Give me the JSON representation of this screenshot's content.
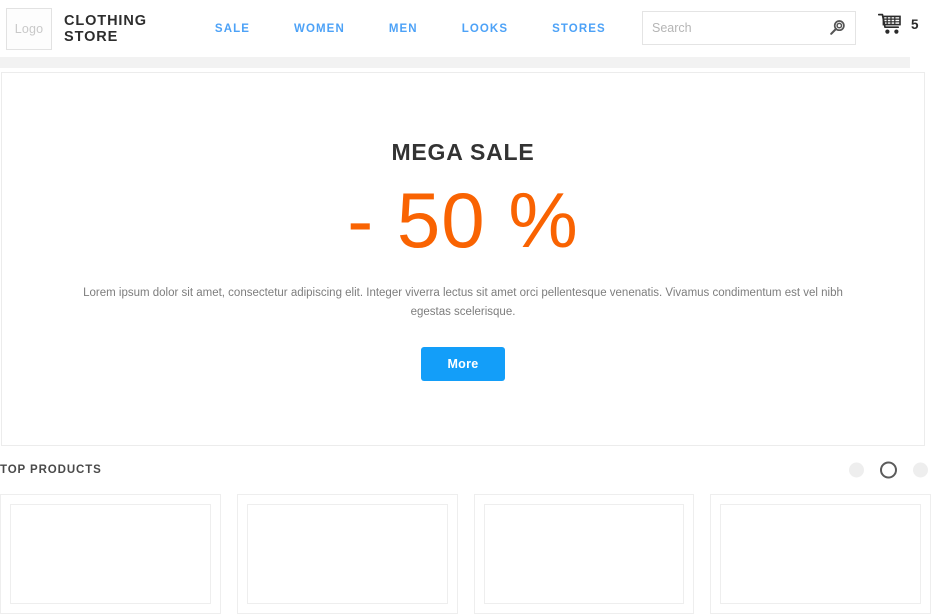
{
  "header": {
    "logo_label": "Logo",
    "brand_name": "CLOTHING\nSTORE",
    "nav": [
      {
        "label": "SALE"
      },
      {
        "label": "WOMEN"
      },
      {
        "label": "MEN"
      },
      {
        "label": "LOOKS"
      },
      {
        "label": "STORES"
      }
    ],
    "search": {
      "value": "",
      "placeholder": "Search",
      "icon": "search-icon"
    },
    "cart": {
      "icon": "shopping-cart-icon",
      "count": "5"
    }
  },
  "hero": {
    "title": "MEGA SALE",
    "discount": "- 50 %",
    "description": "Lorem ipsum dolor sit amet, consectetur adipiscing elit. Integer viverra lectus sit amet orci pellentesque venenatis. Vivamus condimentum est vel nibh egestas scelerisque.",
    "button_label": "More"
  },
  "top_products": {
    "title": "TOP PRODUCTS",
    "carousel_dots": [
      {
        "state": "inactive"
      },
      {
        "state": "active"
      },
      {
        "state": "inactive"
      }
    ],
    "cards": [
      {
        "image_placeholder": ""
      },
      {
        "image_placeholder": ""
      },
      {
        "image_placeholder": ""
      },
      {
        "image_placeholder": ""
      }
    ]
  },
  "colors": {
    "nav_link": "#4da2f7",
    "discount_orange": "#f96302",
    "button_blue": "#139ef9",
    "border_gray": "#ececec",
    "band_gray": "#f2f2f2"
  }
}
